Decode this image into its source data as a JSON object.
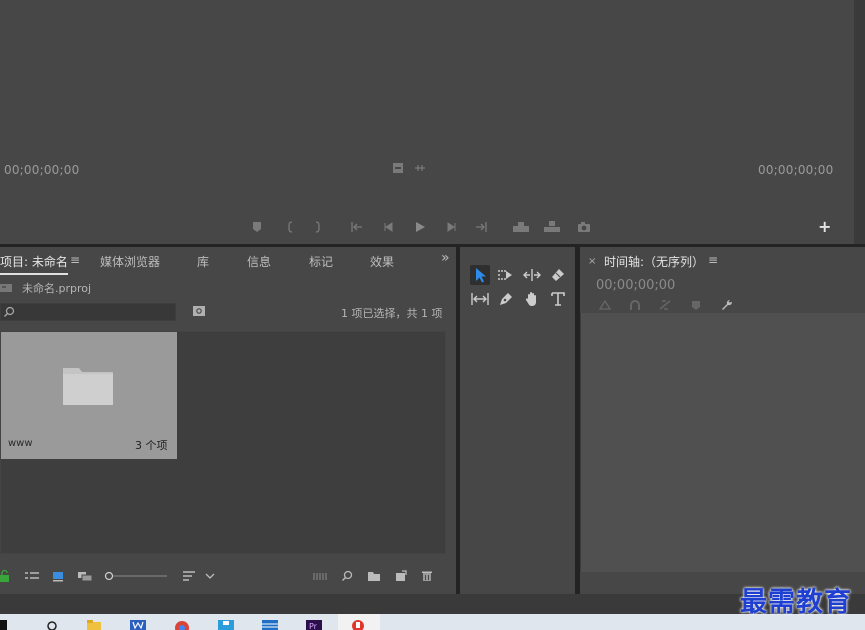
{
  "program_monitor": {
    "timecode_in": "00;00;00;00",
    "timecode_out": "00;00;00;00"
  },
  "project_panel": {
    "tabs": [
      {
        "label": "项目: 未命名"
      },
      {
        "label": "媒体浏览器"
      },
      {
        "label": "库"
      },
      {
        "label": "信息"
      },
      {
        "label": "标记"
      },
      {
        "label": "效果"
      }
    ],
    "tab_menu_glyph": "≡",
    "overflow_glyph": "»",
    "project_file": "未命名.prproj",
    "selection_status": "1 项已选择，共 1 项",
    "bin": {
      "name": "www",
      "count": "3 个项"
    }
  },
  "timeline_panel": {
    "close_glyph": "×",
    "title": "时间轴:（无序列）",
    "menu_glyph": "≡",
    "timecode": "00;00;00;00"
  },
  "watermark": "最需教育",
  "colors": {
    "panel_bg": "#474747",
    "frame_bg": "#232323",
    "selected_tool": "#2d8ceb",
    "watermark": "#1f3fd1"
  }
}
